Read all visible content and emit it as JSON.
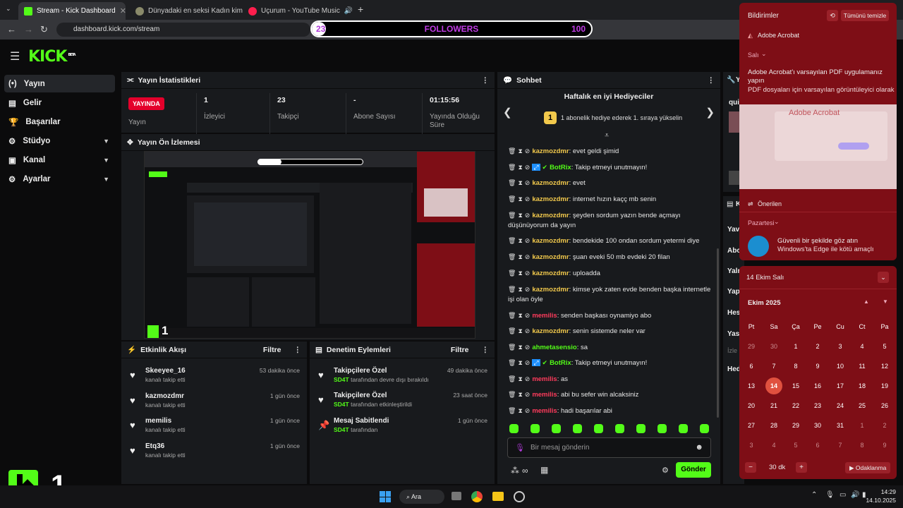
{
  "browser": {
    "tabs": [
      {
        "title": "Stream - Kick Dashboard",
        "color": "#53fc18"
      },
      {
        "title": "Dünyadaki en seksi Kadın kim",
        "color": "#8a8a6a"
      },
      {
        "title": "Uçurum - YouTube Music",
        "color": "#ff1e4d"
      }
    ],
    "new_tab": "+",
    "url": "dashboard.kick.com/stream"
  },
  "follower_goal": {
    "current": "23",
    "label": "FOLLOWERS",
    "target": "100",
    "progress": 0.23
  },
  "brand": {
    "logo": "KICK",
    "beta": "BETA",
    "accent": "#53fc18"
  },
  "sidebar": {
    "items": [
      {
        "label": "Yayın",
        "icon": "broadcast-icon"
      },
      {
        "label": "Gelir",
        "icon": "revenue-icon"
      },
      {
        "label": "Başarılar",
        "icon": "trophy-icon"
      },
      {
        "label": "Stüdyo",
        "icon": "gear-icon"
      },
      {
        "label": "Kanal",
        "icon": "channel-icon"
      },
      {
        "label": "Ayarlar",
        "icon": "settings-icon"
      }
    ]
  },
  "stats": {
    "title": "Yayın İstatistikleri",
    "live_badge": "YAYINDA",
    "live_label": "Yayın",
    "cells": [
      {
        "value": "1",
        "label": "İzleyici"
      },
      {
        "value": "23",
        "label": "Takipçi"
      },
      {
        "value": "-",
        "label": "Abone Sayısı"
      },
      {
        "value": "01:15:56",
        "label": "Yayında Olduğu Süre"
      }
    ]
  },
  "preview": {
    "title": "Yayın Ön İzlemesi",
    "overlay_count": "1"
  },
  "activity": {
    "title": "Etkinlik Akışı",
    "filter": "Filtre",
    "items": [
      {
        "name": "Skeeyee_16",
        "desc": "kanalı takip etti",
        "time": "53 dakika önce"
      },
      {
        "name": "kazmozdmr",
        "desc": "kanalı takip etti",
        "time": "1 gün önce"
      },
      {
        "name": "memilis",
        "desc": "kanalı takip etti",
        "time": "1 gün önce"
      },
      {
        "name": "Etq36",
        "desc": "kanalı takip etti",
        "time": "1 gün önce"
      }
    ]
  },
  "moderation": {
    "title": "Denetim Eylemleri",
    "filter": "Filtre",
    "items": [
      {
        "name": "Takipçilere Özel",
        "user": "SD4T",
        "desc": "tarafından devre dışı bırakıldı",
        "time": "49 dakika önce"
      },
      {
        "name": "Takipçilere Özel",
        "user": "SD4T",
        "desc": "tarafından etkinleştirildi",
        "time": "23 saat önce"
      },
      {
        "name": "Mesaj Sabitlendi",
        "user": "SD4T",
        "desc": "tarafından",
        "time": "1 gün önce"
      }
    ]
  },
  "chat": {
    "title": "Sohbet",
    "gifters_title": "Haftalık en iyi Hediyeciler",
    "gifters_text": "1 abonelik hediye ederek 1. sıraya yükselin",
    "gifters_rank": "1",
    "messages": [
      {
        "user": "kazmozdmr",
        "color": "#f2c94c",
        "text": "evet geldi şimid"
      },
      {
        "user": "BotRix",
        "color": "#53fc18",
        "text": "Takip etmeyi unutmayın!",
        "bot": true
      },
      {
        "user": "kazmozdmr",
        "color": "#f2c94c",
        "text": "evet"
      },
      {
        "user": "kazmozdmr",
        "color": "#f2c94c",
        "text": "internet hızın kaçç mb senin"
      },
      {
        "user": "kazmozdmr",
        "color": "#f2c94c",
        "text": "şeyden sordum yazın bende açmayı düşünüyorum da yayın"
      },
      {
        "user": "kazmozdmr",
        "color": "#f2c94c",
        "text": "bendekide 100 ondan sordum yetermi diye"
      },
      {
        "user": "kazmozdmr",
        "color": "#f2c94c",
        "text": "şuan eveki 50 mb evdeki 20 filan"
      },
      {
        "user": "kazmozdmr",
        "color": "#f2c94c",
        "text": "uploadda"
      },
      {
        "user": "kazmozdmr",
        "color": "#f2c94c",
        "text": "kimse yok zaten evde benden başka internetle işi olan öyle"
      },
      {
        "user": "memilis",
        "color": "#ff3b5c",
        "text": "senden başkası oynamiyo abo"
      },
      {
        "user": "kazmozdmr",
        "color": "#f2c94c",
        "text": "senin sistemde neler var"
      },
      {
        "user": "ahmetasensio",
        "color": "#53fc18",
        "text": "sa"
      },
      {
        "user": "BotRix",
        "color": "#53fc18",
        "text": "Takip etmeyi unutmayın!",
        "bot": true
      },
      {
        "user": "memilis",
        "color": "#ff3b5c",
        "text": "as"
      },
      {
        "user": "memilis",
        "color": "#ff3b5c",
        "text": "abi bu sefer win alcaksiniz"
      },
      {
        "user": "memilis",
        "color": "#ff3b5c",
        "text": "hadi başarılar abi"
      }
    ],
    "input_placeholder": "Bir mesaj gönderin",
    "send": "Gönder"
  },
  "right_panel": {
    "title_initial": "Y",
    "title_initial2": "K",
    "rows": [
      "qui",
      "Yav",
      "Abo",
      "Yalr",
      "Yap",
      "Hes",
      "Yas",
      "İzle",
      "Hed"
    ]
  },
  "notifications": {
    "title": "Bildirimler",
    "clear_all": "Tümünü temizle",
    "app": "Adobe Acrobat",
    "group": "Salı",
    "headline": "Adobe Acrobat'ı varsayılan PDF uygulamanız yapın",
    "body": "PDF dosyaları için varsayılan görüntüleyici olarak",
    "thumb_label": "Adobe Acrobat",
    "suggested": "Önerilen",
    "group2": "Pazartesi",
    "edge_title": "Güvenli bir şekilde göz atın",
    "edge_body": "Windows'ta Edge ile kötü amaçlı"
  },
  "calendar": {
    "date_header": "14 Ekim Salı",
    "month": "Ekim 2025",
    "weekdays": [
      "Pt",
      "Sa",
      "Ça",
      "Pe",
      "Cu",
      "Ct",
      "Pa"
    ],
    "weeks": [
      [
        "29",
        "30",
        "1",
        "2",
        "3",
        "4",
        "5"
      ],
      [
        "6",
        "7",
        "8",
        "9",
        "10",
        "11",
        "12"
      ],
      [
        "13",
        "14",
        "15",
        "16",
        "17",
        "18",
        "19"
      ],
      [
        "20",
        "21",
        "22",
        "23",
        "24",
        "25",
        "26"
      ],
      [
        "27",
        "28",
        "29",
        "30",
        "31",
        "1",
        "2"
      ],
      [
        "3",
        "4",
        "5",
        "6",
        "7",
        "8",
        "9"
      ]
    ],
    "today": "14",
    "focus_minus": "−",
    "focus_value": "30 dk",
    "focus_plus": "+",
    "focus_label": "Odaklanma"
  },
  "taskbar": {
    "search": "Ara",
    "time": "14:29",
    "date": "14.10.2025"
  }
}
